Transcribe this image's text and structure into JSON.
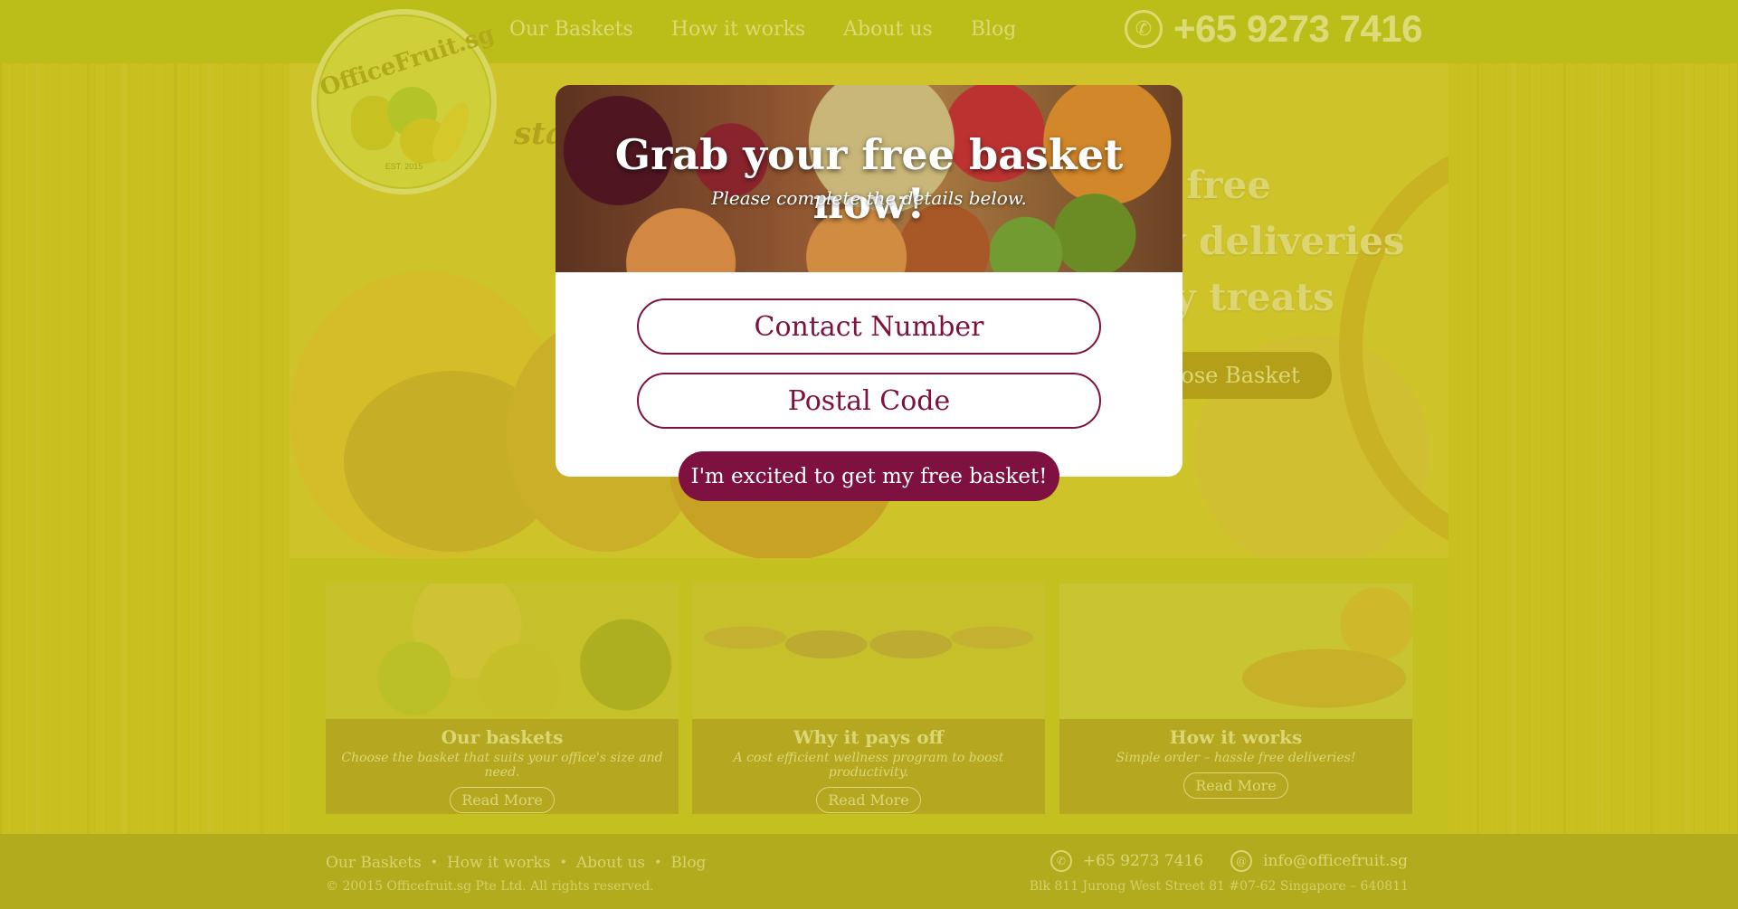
{
  "header": {
    "nav": [
      "Our Baskets",
      "How it works",
      "About us",
      "Blog"
    ],
    "phone": "+65 9273 7416",
    "phone_icon": "phone-icon"
  },
  "logo": {
    "text": "OfficeFruit.sg",
    "est": "EST. 2015"
  },
  "hero": {
    "tagline": "sta",
    "lines": [
      "e free",
      "ly deliveries",
      "ay treats"
    ],
    "choose_button": "ose Basket"
  },
  "modal": {
    "title": "Grab your free basket now!",
    "subtitle": "Please complete the details below.",
    "contact_placeholder": "Contact Number",
    "postal_placeholder": "Postal Code",
    "submit_label": "I'm excited to get my free basket!"
  },
  "cards": [
    {
      "title": "Our baskets",
      "desc": "Choose the basket that suits your office's size and need.",
      "button": "Read More"
    },
    {
      "title": "Why it pays off",
      "desc": "A cost efficient wellness program to boost productivity.",
      "button": "Read More"
    },
    {
      "title": "How it works",
      "desc": "Simple order – hassle free deliveries!",
      "button": "Read More"
    }
  ],
  "footer": {
    "nav": [
      "Our Baskets",
      "How it works",
      "About us",
      "Blog"
    ],
    "copyright": "© 20015 Officefruit.sg Pte Ltd. All rights reserved.",
    "phone": "+65 9273 7416",
    "email": "info@officefruit.sg",
    "address": "Blk 811 Jurong West Street 81 #07-62 Singapore – 640811"
  },
  "colors": {
    "accent": "#7e1140",
    "header_bg": "#b3bd1e",
    "overlay": "#c6be14"
  }
}
